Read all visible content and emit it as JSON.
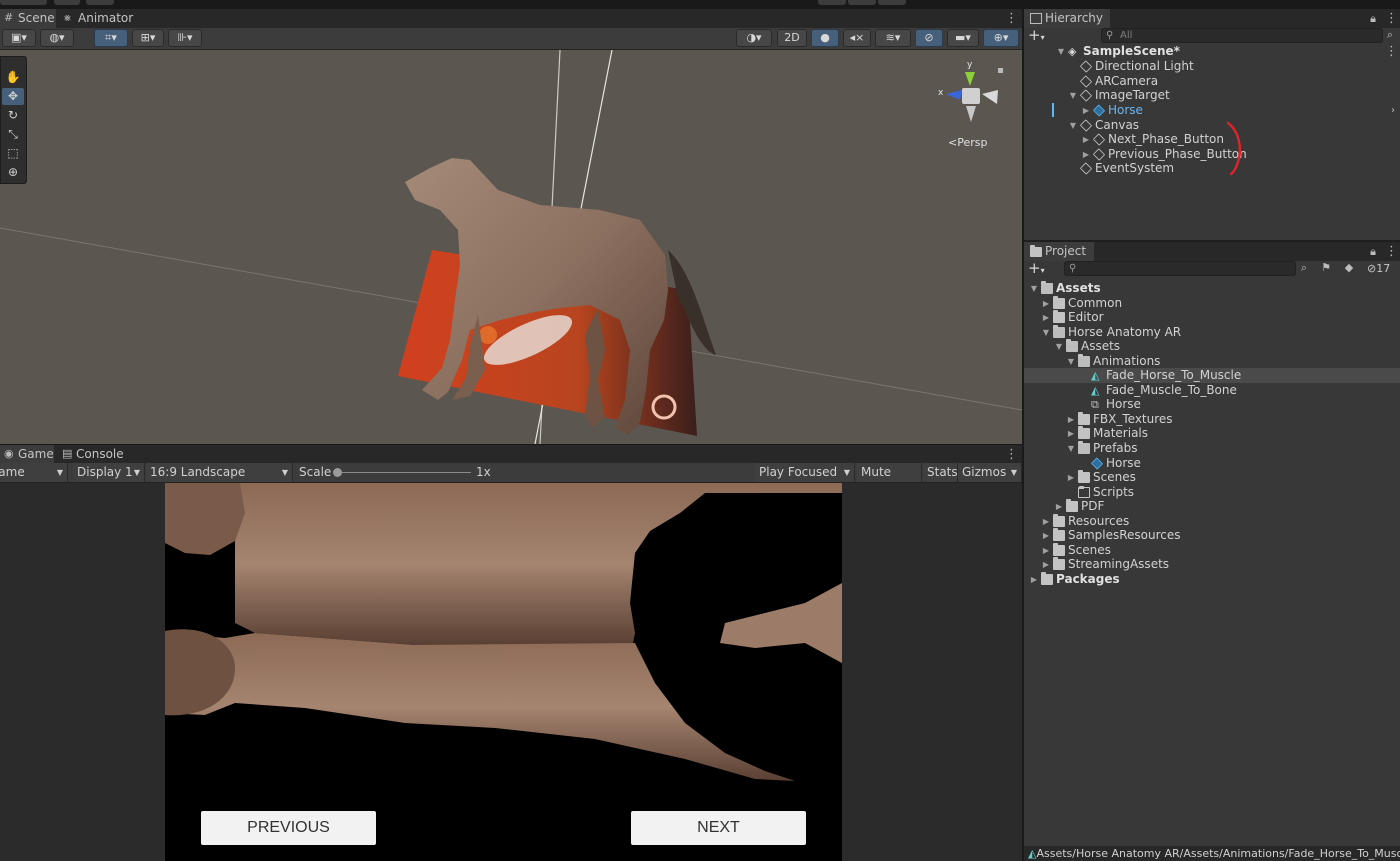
{
  "scene_panel": {
    "tabs": [
      {
        "label": "Scene"
      },
      {
        "label": "Animator"
      }
    ],
    "toolbar": {
      "view_2d_label": "2D"
    },
    "gizmo": {
      "x_label": "x",
      "y_label": "y",
      "projection_label": "Persp"
    }
  },
  "game_panel": {
    "tabs": [
      {
        "label": "Game"
      },
      {
        "label": "Console"
      }
    ],
    "toolbar": {
      "view_mode": "Game",
      "display": "Display 1",
      "aspect": "16:9 Landscape",
      "scale_label": "Scale",
      "scale_value": "1x",
      "play_mode": "Play Focused",
      "mute_label": "Mute Audio",
      "stats_label": "Stats",
      "gizmos_label": "Gizmos"
    },
    "buttons": {
      "previous": "PREVIOUS",
      "next": "NEXT"
    }
  },
  "hierarchy": {
    "title": "Hierarchy",
    "search_placeholder": "All",
    "items": [
      {
        "label": "SampleScene*"
      },
      {
        "label": "Directional Light"
      },
      {
        "label": "ARCamera"
      },
      {
        "label": "ImageTarget"
      },
      {
        "label": "Horse"
      },
      {
        "label": "Canvas"
      },
      {
        "label": "Next_Phase_Button"
      },
      {
        "label": "Previous_Phase_Button"
      },
      {
        "label": "EventSystem"
      }
    ]
  },
  "project": {
    "title": "Project",
    "hidden_count": "17",
    "items": [
      {
        "label": "Assets"
      },
      {
        "label": "Common"
      },
      {
        "label": "Editor"
      },
      {
        "label": "Horse Anatomy AR"
      },
      {
        "label": "Assets"
      },
      {
        "label": "Animations"
      },
      {
        "label": "Fade_Horse_To_Muscle"
      },
      {
        "label": "Fade_Muscle_To_Bone"
      },
      {
        "label": "Horse"
      },
      {
        "label": "FBX_Textures"
      },
      {
        "label": "Materials"
      },
      {
        "label": "Prefabs"
      },
      {
        "label": "Horse"
      },
      {
        "label": "Scenes"
      },
      {
        "label": "Scripts"
      },
      {
        "label": "PDF"
      },
      {
        "label": "Resources"
      },
      {
        "label": "SamplesResources"
      },
      {
        "label": "Scenes"
      },
      {
        "label": "StreamingAssets"
      },
      {
        "label": "Packages"
      }
    ],
    "status_path": "Assets/Horse Anatomy AR/Assets/Animations/Fade_Horse_To_Muscle"
  },
  "colors": {
    "accent_blue": "#46607c",
    "selection_blue": "#5db9ef",
    "annotation_red": "#e0232a",
    "viewport_bg": "#5c5650"
  }
}
